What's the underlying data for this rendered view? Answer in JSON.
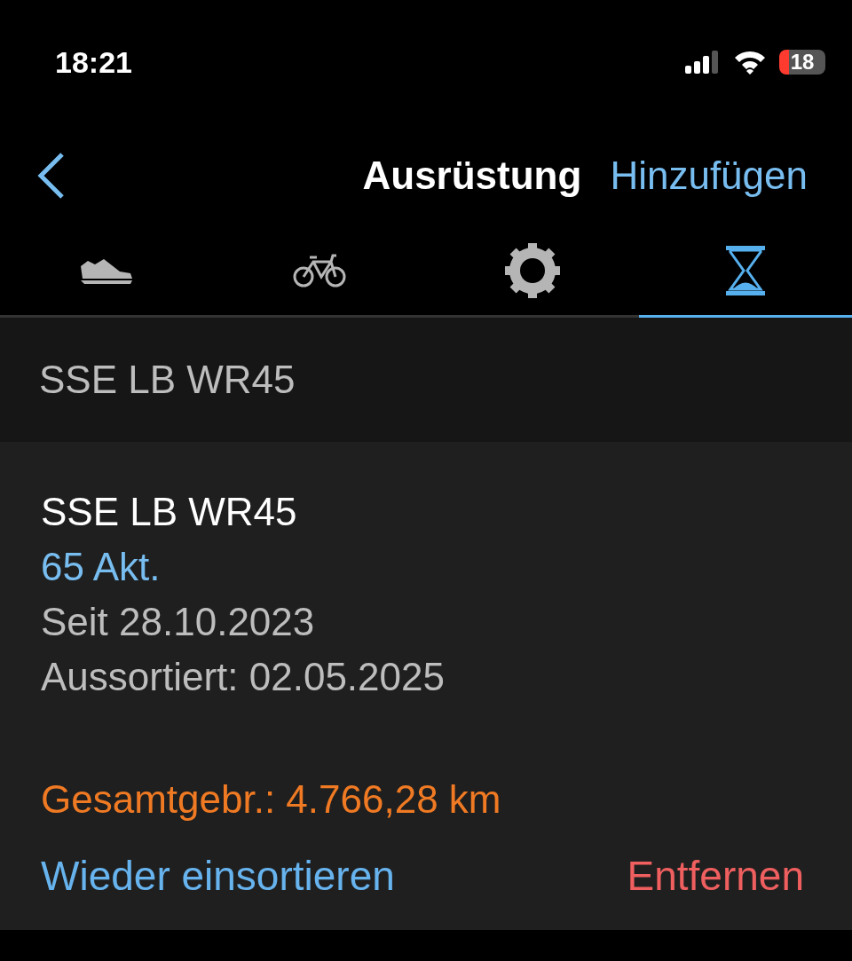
{
  "status_bar": {
    "time": "18:21",
    "battery": "18"
  },
  "nav": {
    "title": "Ausrüstung",
    "action": "Hinzufügen"
  },
  "tabs": [
    {
      "kind": "shoe",
      "selected": false
    },
    {
      "kind": "bike",
      "selected": false
    },
    {
      "kind": "gear",
      "selected": false
    },
    {
      "kind": "hourglass",
      "selected": true
    }
  ],
  "section": {
    "title": "SSE LB WR45"
  },
  "item": {
    "name": "SSE LB WR45",
    "activities": "65 Akt.",
    "since": "Seit 28.10.2023",
    "retired": "Aussortiert: 02.05.2025",
    "total": "Gesamtgebr.: 4.766,28 km"
  },
  "actions": {
    "restore": "Wieder einsortieren",
    "remove": "Entfernen"
  }
}
